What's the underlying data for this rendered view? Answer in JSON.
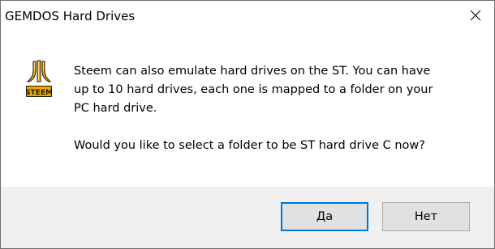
{
  "window": {
    "title": "GEMDOS Hard Drives",
    "close_icon": "close-icon"
  },
  "app_icon": {
    "name": "steem-logo-icon",
    "logo_text": "STEEM",
    "colors": {
      "gold": "#f0a800",
      "dark": "#1a1a1a",
      "highlight": "#ffe070"
    }
  },
  "message": {
    "paragraph1": "Steem can also emulate hard drives on the ST. You can have\nup to 10 hard drives, each one is mapped to a folder on your\nPC hard drive.",
    "paragraph2": "Would you like to select a folder to be ST hard drive C now?"
  },
  "buttons": {
    "yes_label": "Да",
    "no_label": "Нет",
    "default": "yes"
  },
  "colors": {
    "footer_bg": "#f0f0f0",
    "button_bg": "#e1e1e1",
    "focus_border": "#0078d7"
  }
}
